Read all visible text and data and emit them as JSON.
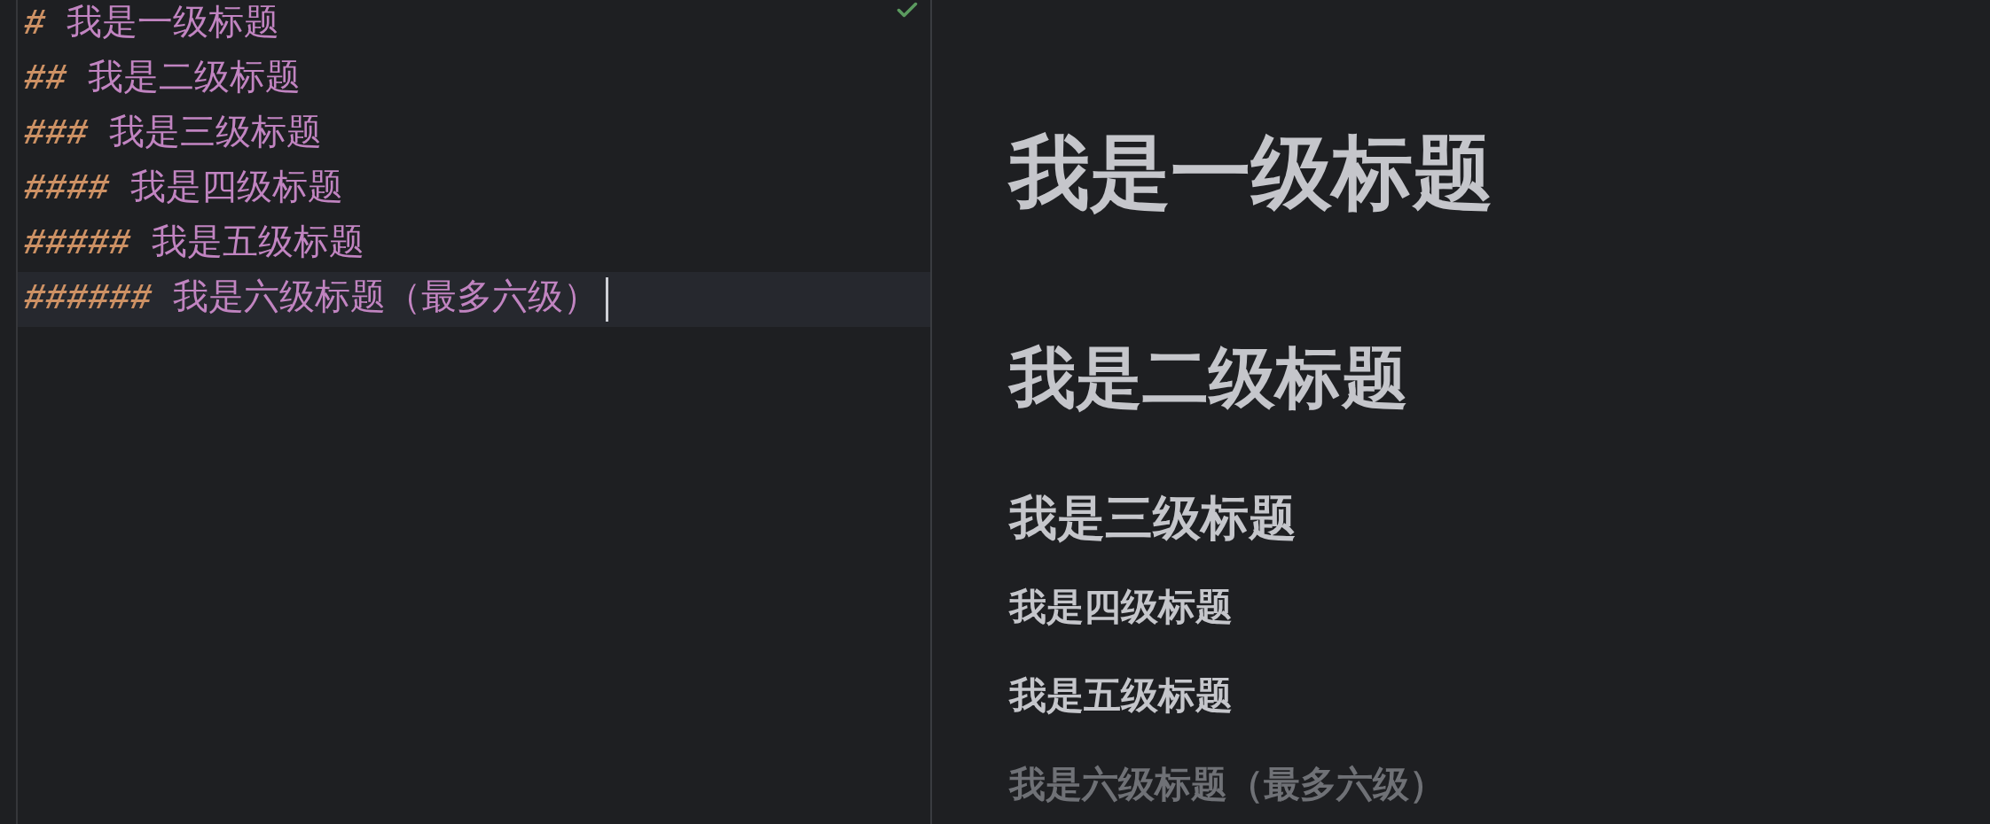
{
  "editor": {
    "lines": [
      {
        "marker": "#",
        "text": "我是一级标题",
        "current": false
      },
      {
        "marker": "##",
        "text": "我是二级标题",
        "current": false
      },
      {
        "marker": "###",
        "text": "我是三级标题",
        "current": false
      },
      {
        "marker": "####",
        "text": "我是四级标题",
        "current": false
      },
      {
        "marker": "#####",
        "text": "我是五级标题",
        "current": false
      },
      {
        "marker": "######",
        "text": "我是六级标题（最多六级）",
        "current": true
      }
    ]
  },
  "preview": {
    "headings": [
      {
        "kind": "h1",
        "text": "我是一级标题"
      },
      {
        "kind": "h2",
        "text": "我是二级标题"
      },
      {
        "kind": "h3",
        "text": "我是三级标题"
      },
      {
        "kind": "h4",
        "text": "我是四级标题"
      },
      {
        "kind": "h5",
        "text": "我是五级标题"
      },
      {
        "kind": "h6",
        "text": "我是六级标题（最多六级）"
      }
    ]
  }
}
